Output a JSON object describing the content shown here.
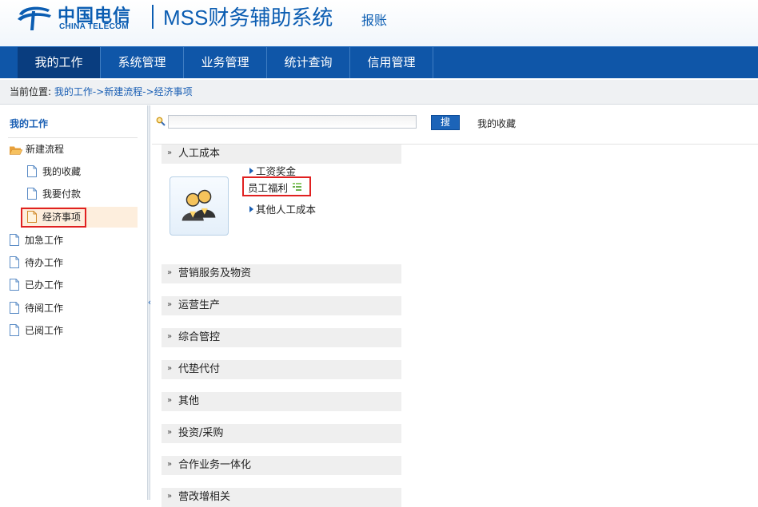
{
  "header": {
    "logo_cn": "中国电信",
    "logo_en": "CHINA TELECOM",
    "system_title": "MSS财务辅助系统",
    "system_sub": "报账",
    "brand_color": "#0b5db2"
  },
  "topnav": {
    "tabs": [
      {
        "label": "我的工作",
        "active": true
      },
      {
        "label": "系统管理",
        "active": false
      },
      {
        "label": "业务管理",
        "active": false
      },
      {
        "label": "统计查询",
        "active": false
      },
      {
        "label": "信用管理",
        "active": false
      }
    ]
  },
  "breadcrumb": {
    "prefix": "当前位置:",
    "path": "我的工作->新建流程->经济事项"
  },
  "sidebar": {
    "title": "我的工作",
    "items": [
      {
        "label": "新建流程",
        "icon": "folder-open-icon"
      },
      {
        "label": "我的收藏",
        "icon": "document-icon"
      },
      {
        "label": "我要付款",
        "icon": "document-icon"
      },
      {
        "label": "经济事项",
        "icon": "document-icon",
        "selected": true
      },
      {
        "label": "加急工作",
        "icon": "document-icon"
      },
      {
        "label": "待办工作",
        "icon": "document-icon"
      },
      {
        "label": "已办工作",
        "icon": "document-icon"
      },
      {
        "label": "待阅工作",
        "icon": "document-icon"
      },
      {
        "label": "已阅工作",
        "icon": "document-icon"
      }
    ]
  },
  "search": {
    "value": "",
    "button_label": "搜",
    "favorites_label": "我的收藏"
  },
  "categories": [
    {
      "label": "人工成本",
      "expanded": true
    },
    {
      "label": "营销服务及物资"
    },
    {
      "label": "运营生产"
    },
    {
      "label": "综合管控"
    },
    {
      "label": "代垫代付"
    },
    {
      "label": "其他"
    },
    {
      "label": "投资/采购"
    },
    {
      "label": "合作业务一体化"
    },
    {
      "label": "营改增相关"
    }
  ],
  "labor_cost_items": [
    {
      "label": "工资奖金"
    },
    {
      "label": "员工福利",
      "highlighted": true
    },
    {
      "label": "其他人工成本"
    }
  ],
  "highlight_color": "#e02020"
}
